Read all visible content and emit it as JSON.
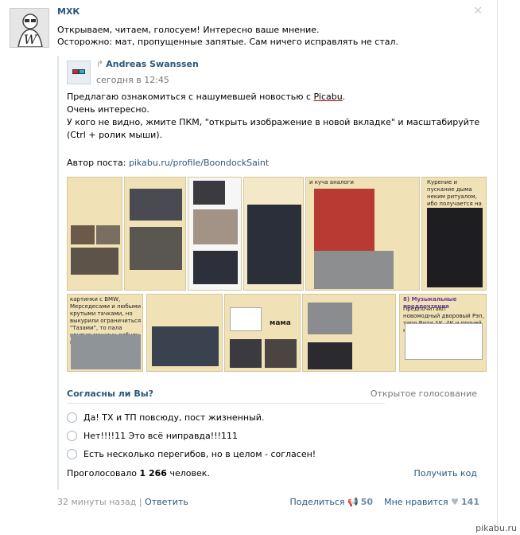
{
  "post": {
    "author": "МХК",
    "text_line1": "Открываем, читаем, голосуем! Интересно ваше мнение.",
    "text_line2": "Осторожно: мат, пропущенные запятые. Сам ничего исправлять не стал."
  },
  "repost": {
    "author": "Andreas Swanssen",
    "date": "сегодня в 12:45",
    "line1_pre": "Предлагаю ознакомиться с нашумевшей новостью с ",
    "line1_link": "Picabu",
    "line1_post": ".",
    "line2": "Очень интересно.",
    "line3": "У кого не видно, жмите ПКМ, \"открыть изображение в новой вкладке\" и масштабируйте (Ctrl + ролик мыши).",
    "author_label": "Автор поста: ",
    "author_link": "pikabu.ru/profile/BoondockSaint"
  },
  "collage": {
    "captions": {
      "t3": "и куча аналоги",
      "t5": "Курение и пускание дыма неким ритуалом, ибо получается на фото",
      "t6": "картинки с BMW, Мерседесами и любыми крутыми тачками, но выкурили ограничиться \"Тазами\", то пала крутую машину добуду не покупал :D",
      "t8": "мама",
      "t10": "8) Музыкальные предпочтения",
      "t10b": "Предпочитают новомодный дворовый Рэп, типо Вити АК, 4К и прочей неприятной хлебы"
    }
  },
  "poll": {
    "title": "Согласны ли Вы?",
    "kind": "Открытое голосование",
    "options": [
      "Да! ТХ и ТП повсюду, пост жизненный.",
      "Нет!!!!11 Это всё ниправда!!!111",
      "Есть несколько перегибов, но в целом - согласен!"
    ],
    "total_pre": "Проголосовало ",
    "total_num": "1 266",
    "total_post": " человек.",
    "get_code": "Получить код"
  },
  "footer": {
    "time": "32 минуты назад",
    "separator": " | ",
    "reply": "Ответить",
    "share": "Поделиться",
    "share_count": "50",
    "like": "Мне нравится",
    "like_count": "141"
  },
  "watermark": "pikabu.ru"
}
